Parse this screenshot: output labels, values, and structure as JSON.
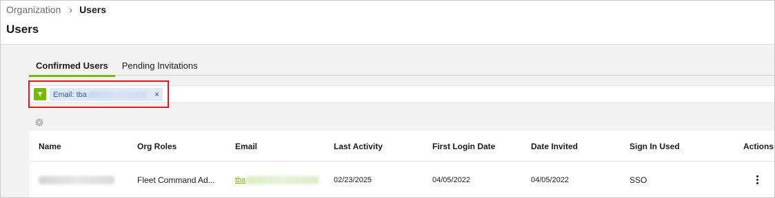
{
  "breadcrumb": {
    "parent": "Organization",
    "separator": "›",
    "current": "Users"
  },
  "page": {
    "title": "Users"
  },
  "tabs": [
    {
      "label": "Confirmed Users",
      "active": true
    },
    {
      "label": "Pending Invitations",
      "active": false
    }
  ],
  "filter": {
    "icon": "filter-icon",
    "chip_label": "Email: tba",
    "close_glyph": "×"
  },
  "settings": {
    "icon": "gear-icon"
  },
  "table": {
    "columns": [
      "Name",
      "Org Roles",
      "Email",
      "Last Activity",
      "First Login Date",
      "Date Invited",
      "Sign In Used",
      "Actions"
    ],
    "rows": [
      {
        "name": "",
        "org_roles": "Fleet Command Ad...",
        "email": "tba",
        "last_activity": "02/23/2025",
        "first_login_date": "04/05/2022",
        "date_invited": "04/05/2022",
        "sign_in_used": "SSO",
        "actions_icon": "kebab-menu-icon"
      }
    ]
  },
  "colors": {
    "accent": "#76b900",
    "highlight": "#e0161b",
    "chip_bg": "#dfe9f5",
    "chip_text": "#2b5ea8"
  }
}
